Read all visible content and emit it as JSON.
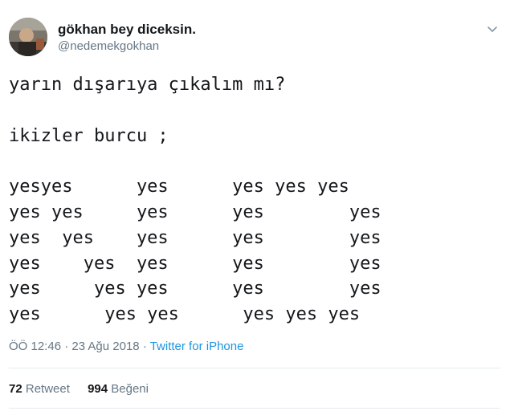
{
  "user": {
    "display_name": "gökhan bey diceksin.",
    "handle": "@nedemekgokhan"
  },
  "menu_icon": "chevron-down-icon",
  "tweet": {
    "text": "yarın dışarıya çıkalım mı?\n\nikizler burcu ;\n\nyesyes      yes      yes yes yes\nyes yes     yes      yes        yes\nyes  yes    yes      yes        yes\nyes    yes  yes      yes        yes\nyes     yes yes      yes        yes\nyes      yes yes      yes yes yes",
    "time": "ÖÖ 12:46",
    "separator": " · ",
    "date": "23 Ağu 2018",
    "source": "Twitter for iPhone"
  },
  "stats": {
    "retweets_count": "72",
    "retweets_label": "Retweet",
    "likes_count": "994",
    "likes_label": "Beğeni"
  }
}
